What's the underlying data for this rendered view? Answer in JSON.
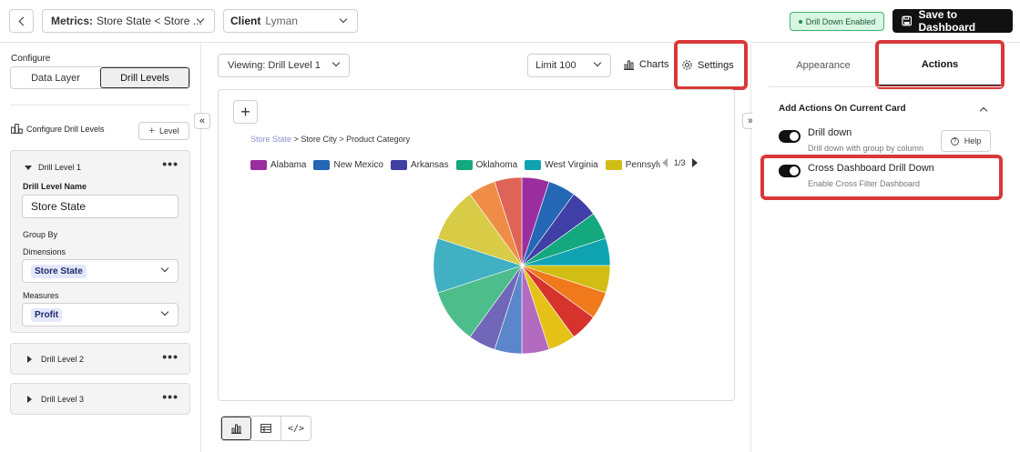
{
  "topbar": {
    "metrics_label": "Metrics:",
    "metrics_value": "Store State < Store ...",
    "client_label": "Client",
    "client_value": "Lyman",
    "drill_badge": "Drill Down Enabled",
    "save_button": "Save to Dashboard"
  },
  "left": {
    "configure_title": "Configure",
    "tabs": [
      "Data Layer",
      "Drill Levels"
    ],
    "active_tab": "Drill Levels",
    "configure_drill_levels": "Configure Drill Levels",
    "add_level_button": "Level",
    "drill_level_1": {
      "title": "Drill Level 1",
      "name_label": "Drill Level Name",
      "name_value": "Store State",
      "group_by": "Group By",
      "dimensions_label": "Dimensions",
      "dimensions_value": "Store State",
      "measures_label": "Measures",
      "measures_value": "Profit"
    },
    "drill_level_2": "Drill Level 2",
    "drill_level_3": "Drill Level 3"
  },
  "center": {
    "viewing": "Viewing: Drill Level 1",
    "limit": "Limit 100",
    "charts_button": "Charts",
    "settings_button": "Settings",
    "breadcrumb": [
      "Store State",
      "Store City",
      "Product Category"
    ],
    "breadcrumb_sep": ">",
    "pager": "1/3"
  },
  "chart_data": {
    "type": "pie",
    "legend": [
      "Alabama",
      "New Mexico",
      "Arkansas",
      "Oklahoma",
      "West Virginia",
      "Pennsylvani"
    ],
    "legend_colors": [
      "#9b2e9e",
      "#2367b5",
      "#3f3fa5",
      "#14a87e",
      "#0fa3b1",
      "#d1bd14"
    ],
    "slices": [
      {
        "color": "#9b2e9e",
        "value": 1
      },
      {
        "color": "#2367b5",
        "value": 1
      },
      {
        "color": "#3f3fa5",
        "value": 1
      },
      {
        "color": "#14a87e",
        "value": 1
      },
      {
        "color": "#0fa3b1",
        "value": 1
      },
      {
        "color": "#d1bd14",
        "value": 1
      },
      {
        "color": "#f0791b",
        "value": 1
      },
      {
        "color": "#d6332c",
        "value": 1
      },
      {
        "color": "#e6c219",
        "value": 1
      },
      {
        "color": "#b36bbf",
        "value": 1
      },
      {
        "color": "#5b86c9",
        "value": 1
      },
      {
        "color": "#7067b8",
        "value": 1
      },
      {
        "color": "#4ebd8c",
        "value": 2
      },
      {
        "color": "#40b0c2",
        "value": 2
      },
      {
        "color": "#d8cc47",
        "value": 2
      },
      {
        "color": "#ef8d46",
        "value": 1
      },
      {
        "color": "#df6458",
        "value": 1
      }
    ]
  },
  "right": {
    "tabs": [
      "Appearance",
      "Actions"
    ],
    "active_tab": "Actions",
    "section_title": "Add Actions On Current Card",
    "drill_down_title": "Drill down",
    "drill_down_desc": "Drill down with group by column",
    "help_button": "Help",
    "cross_title": "Cross Dashboard Drill Down",
    "cross_desc": "Enable Cross Filter Dashboard"
  },
  "colors": {
    "highlight": "#d93838",
    "badge_bg": "#d9f5e3",
    "badge_border": "#3cb36b",
    "save_bg": "#111111"
  }
}
